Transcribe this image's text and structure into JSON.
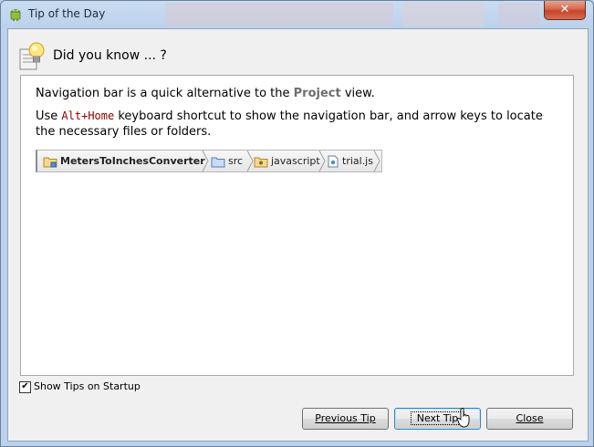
{
  "window": {
    "title": "Tip of the Day",
    "close_label": "✕"
  },
  "header": {
    "text": "Did you know ... ?"
  },
  "tip": {
    "line1_pre": "Navigation bar is a quick alternative to the ",
    "line1_keyword": "Project",
    "line1_post": " view.",
    "line2_pre": "Use ",
    "line2_shortcut": "Alt+Home",
    "line2_post": " keyboard shortcut to show the navigation bar, and arrow keys to locate the necessary files or folders."
  },
  "navbar": {
    "crumbs": [
      "MetersToInchesConverter",
      "src",
      "javascript",
      "trial.js"
    ]
  },
  "footer": {
    "show_tips_label": "Show Tips on Startup",
    "show_tips_checked": true,
    "previous_label": "Previous Tip",
    "next_label": "Next Tip",
    "close_label": "Close"
  }
}
